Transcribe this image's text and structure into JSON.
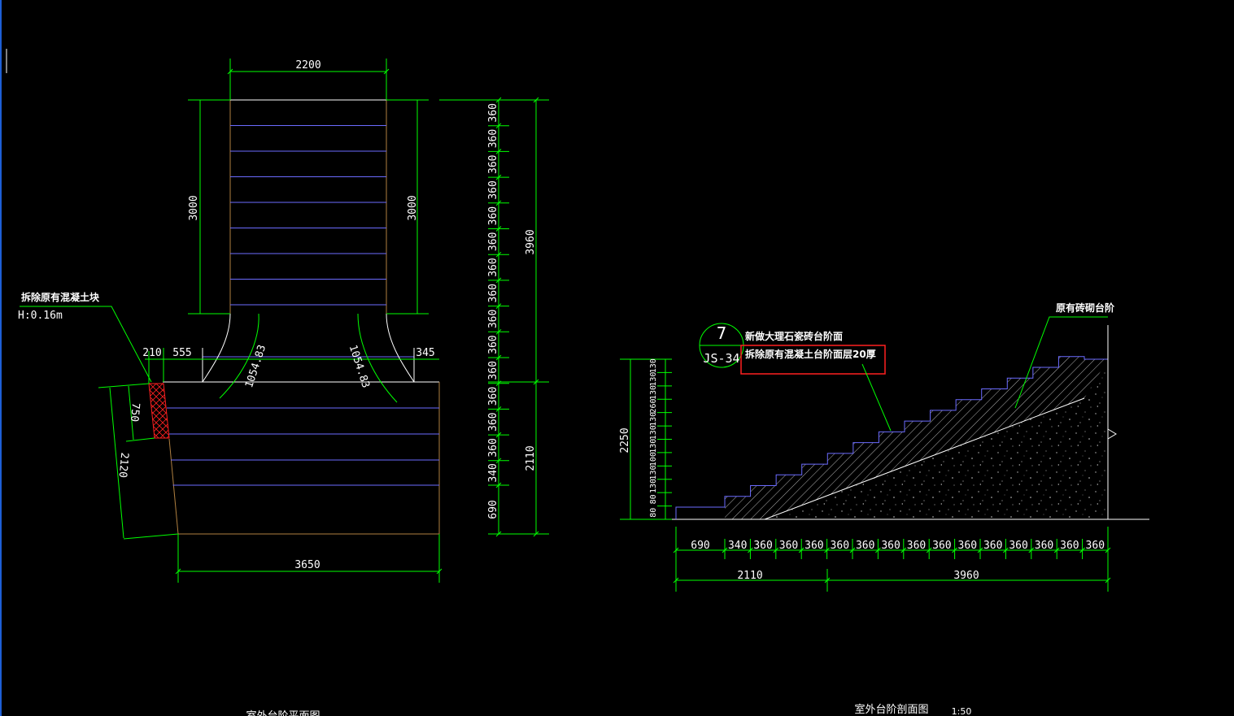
{
  "plan": {
    "dims": {
      "top_width": "2200",
      "left_len": "3000",
      "right_len": "3000",
      "total_len": "3960",
      "lower_len": "2110",
      "bottom_width": "3650",
      "left_offset": "555",
      "right_offset": "345",
      "edge": "210",
      "side_a": "750",
      "side_b": "2120",
      "arc_left": "1054.83",
      "arc_right": "1054.83",
      "treads": [
        "360",
        "360",
        "360",
        "360",
        "360",
        "360",
        "360",
        "360",
        "360",
        "360",
        "360",
        "360",
        "360",
        "360",
        "340",
        "690"
      ]
    },
    "note_demolish": "拆除原有混凝土块",
    "note_height": "H:0.16m",
    "title": "室外台阶平面图"
  },
  "section": {
    "dims": {
      "bottom": [
        "690",
        "340",
        "360",
        "360",
        "360",
        "360",
        "360",
        "360",
        "360",
        "360",
        "360",
        "360",
        "360",
        "360",
        "360",
        "360"
      ],
      "total_left": "2110",
      "total_right": "3960",
      "height": "2250",
      "risers": [
        "80",
        "80",
        "130",
        "130",
        "100",
        "130",
        "130",
        "130",
        "260",
        "130",
        "130",
        "130"
      ]
    },
    "callout_no": "7",
    "callout_ref": "JS-34",
    "note1": "新做大理石瓷砖台阶面",
    "note2": "拆除原有混凝土台阶面层20厚",
    "note_existing": "原有砖砌台阶",
    "title": "室外台阶剖面图",
    "scale": "1:50"
  },
  "colors": {
    "background": "#000000",
    "dimension": "#00ff00",
    "outline": "#ffffff",
    "tread": "#6b6bff",
    "edge": "#b08040",
    "highlight": "#ff2020"
  }
}
